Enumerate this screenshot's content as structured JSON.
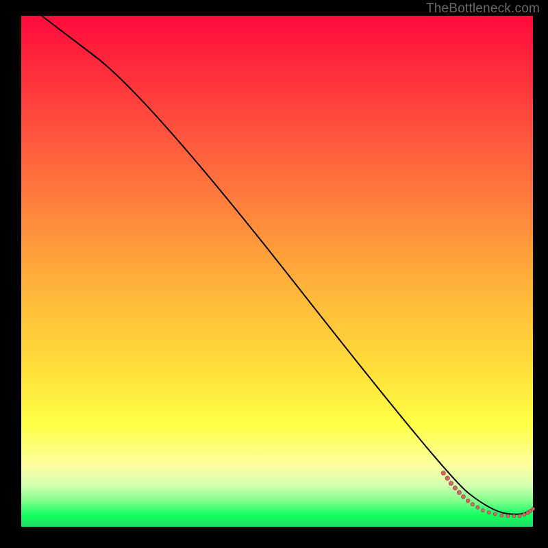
{
  "watermark": "TheBottleneck.com",
  "colors": {
    "curve": "#000000",
    "marker_fill": "#cf6a64",
    "marker_stroke": "#8a3f3b"
  },
  "chart_data": {
    "type": "line",
    "title": "",
    "xlabel": "",
    "ylabel": "",
    "xlim": [
      0,
      100
    ],
    "ylim": [
      0,
      100
    ],
    "poly_nodes": [
      {
        "x": 4.0,
        "y": 100.0
      },
      {
        "x": 25.0,
        "y": 84.0
      },
      {
        "x": 83.0,
        "y": 10.0
      },
      {
        "x": 92.0,
        "y": 3.0
      },
      {
        "x": 97.5,
        "y": 2.2
      },
      {
        "x": 100.0,
        "y": 3.5
      }
    ],
    "markers": [
      {
        "x": 82.5,
        "y": 10.5,
        "r": 3.2
      },
      {
        "x": 83.3,
        "y": 9.5,
        "r": 3.2
      },
      {
        "x": 84.0,
        "y": 8.5,
        "r": 3.2
      },
      {
        "x": 84.8,
        "y": 7.6,
        "r": 3.2
      },
      {
        "x": 85.6,
        "y": 6.7,
        "r": 3.2
      },
      {
        "x": 86.4,
        "y": 5.9,
        "r": 3.0
      },
      {
        "x": 87.3,
        "y": 5.1,
        "r": 2.9
      },
      {
        "x": 88.2,
        "y": 4.4,
        "r": 2.8
      },
      {
        "x": 89.2,
        "y": 3.8,
        "r": 2.7
      },
      {
        "x": 90.2,
        "y": 3.2,
        "r": 2.6
      },
      {
        "x": 91.4,
        "y": 2.8,
        "r": 2.6
      },
      {
        "x": 92.6,
        "y": 2.5,
        "r": 2.6
      },
      {
        "x": 93.9,
        "y": 2.2,
        "r": 2.6
      },
      {
        "x": 95.1,
        "y": 2.1,
        "r": 2.6
      },
      {
        "x": 96.3,
        "y": 2.1,
        "r": 2.6
      },
      {
        "x": 97.4,
        "y": 2.1,
        "r": 2.6
      },
      {
        "x": 98.3,
        "y": 2.4,
        "r": 2.6
      },
      {
        "x": 99.0,
        "y": 2.7,
        "r": 2.6
      },
      {
        "x": 99.5,
        "y": 3.1,
        "r": 2.6
      },
      {
        "x": 100.0,
        "y": 3.5,
        "r": 2.6
      }
    ]
  }
}
